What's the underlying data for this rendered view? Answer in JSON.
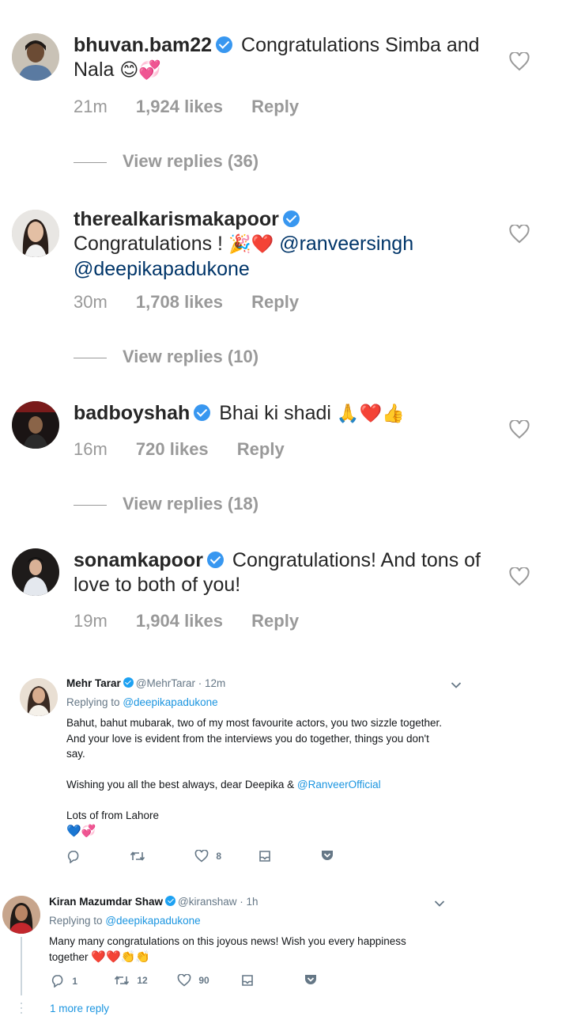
{
  "instagram_comments": [
    {
      "username": "bhuvan.bam22",
      "text": "Congratulations Simba and Nala",
      "emojis": "😊💞",
      "time": "21m",
      "likes": "1,924 likes",
      "reply": "Reply",
      "view_replies": "View replies (36)"
    },
    {
      "username": "therealkarismakapoor",
      "text": "Congratulations !",
      "emojis": "🎉❤️",
      "mention1": "@ranveersingh",
      "mention2": "@deepikapadukone",
      "time": "30m",
      "likes": "1,708 likes",
      "reply": "Reply",
      "view_replies": "View replies (10)"
    },
    {
      "username": "badboyshah",
      "text": "Bhai ki shadi",
      "emojis": "🙏❤️👍",
      "time": "16m",
      "likes": "720 likes",
      "reply": "Reply",
      "view_replies": "View replies (18)"
    },
    {
      "username": "sonamkapoor",
      "text": "Congratulations! And tons of love to both of you!",
      "time": "19m",
      "likes": "1,904 likes",
      "reply": "Reply"
    }
  ],
  "tweets": [
    {
      "name": "Mehr Tarar",
      "handle": "@MehrTarar",
      "time": "· 12m",
      "replying_label": "Replying to",
      "replying_to": "@deepikapadukone",
      "line1": "Bahut, bahut mubarak, two of my most favourite actors, you two sizzle together.",
      "line2": "And your love is evident from the interviews you do together, things you don't",
      "line3": "say.",
      "line4": "Wishing you all the best always, dear Deepika &",
      "line4_mention": "@RanveerOfficial",
      "line5": "Lots of from Lahore",
      "line6_emojis": "💙💞",
      "replies": "",
      "retweets": "",
      "likes": "8"
    },
    {
      "name": "Kiran Mazumdar Shaw",
      "handle": "@kiranshaw",
      "time": "· 1h",
      "replying_label": "Replying to",
      "replying_to": "@deepikapadukone",
      "line1": "Many many congratulations on this joyous news! Wish you every happiness",
      "line2": "together",
      "line2_emojis": "❤️❤️👏👏",
      "replies": "1",
      "retweets": "12",
      "likes": "90",
      "more_reply": "1 more reply"
    }
  ],
  "colors": {
    "ig_text": "#262626",
    "ig_meta": "#999999",
    "ig_verified": "#3897f0",
    "ig_mention": "#003569",
    "tw_link": "#1b95e0",
    "tw_meta": "#657786"
  }
}
